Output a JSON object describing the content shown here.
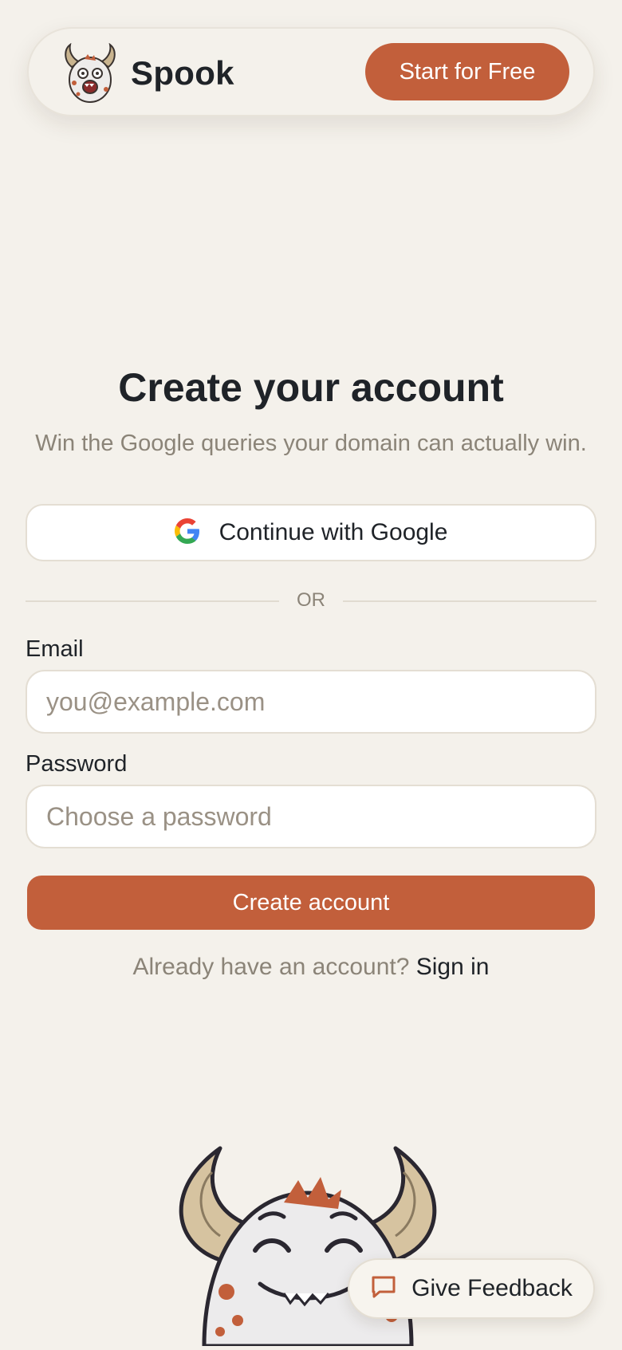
{
  "header": {
    "brand": "Spook",
    "cta_label": "Start for Free"
  },
  "main": {
    "title": "Create your account",
    "subtitle": "Win the Google queries your domain can actually win.",
    "google_button_label": "Continue with Google",
    "divider_text": "OR",
    "email": {
      "label": "Email",
      "placeholder": "you@example.com",
      "value": ""
    },
    "password": {
      "label": "Password",
      "placeholder": "Choose a password",
      "value": ""
    },
    "submit_label": "Create account",
    "signin_prompt": "Already have an account?",
    "signin_link": "Sign in"
  },
  "feedback": {
    "label": "Give Feedback",
    "icon": "chat-bubble-icon"
  },
  "icons": {
    "logo": "monster-logo",
    "google": "google-g-icon",
    "mascot": "horned-monster-mascot"
  },
  "colors": {
    "accent": "#c25f3b",
    "background": "#f4f1eb",
    "text": "#1f2328",
    "muted": "#8b8478"
  }
}
